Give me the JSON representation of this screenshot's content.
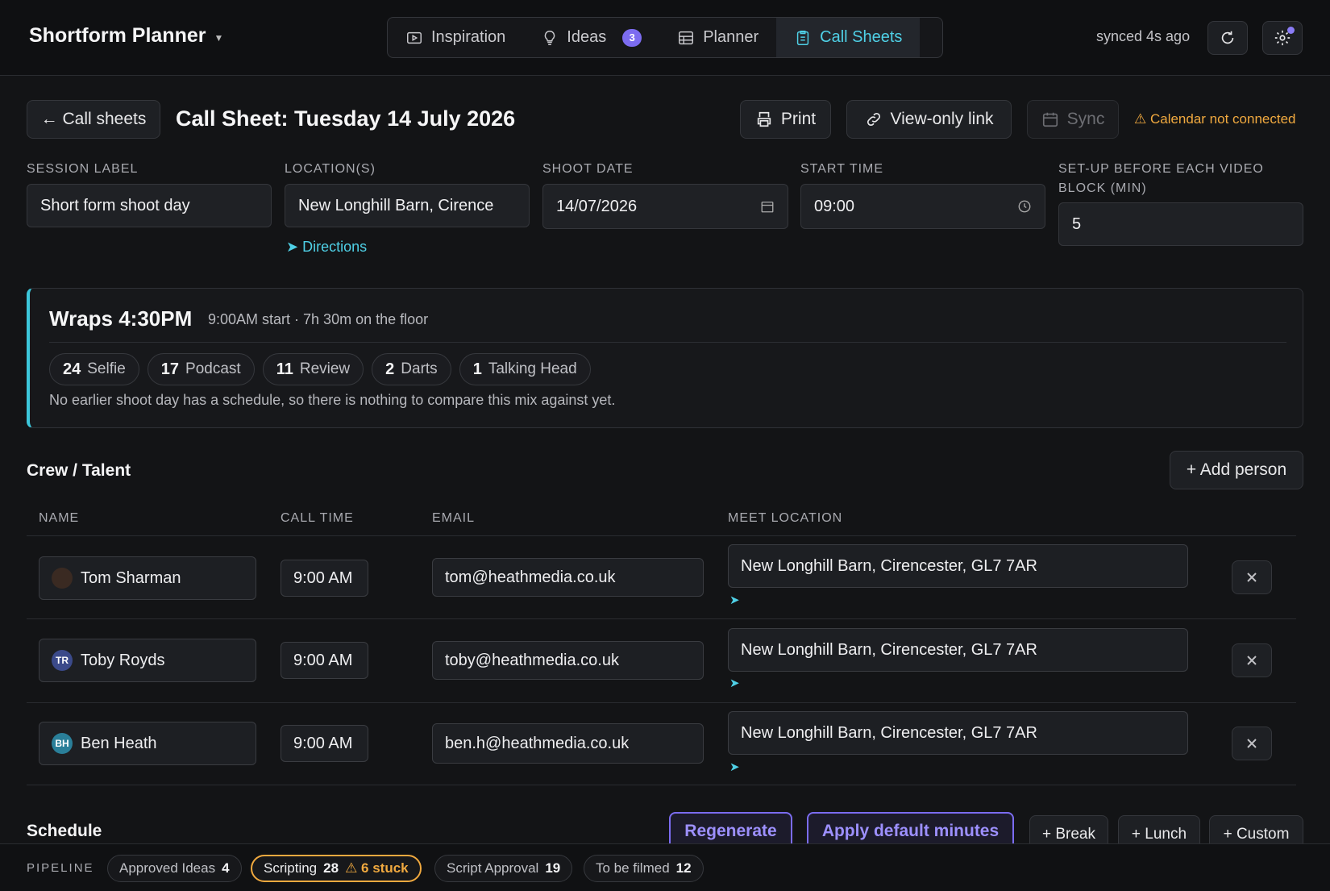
{
  "app": {
    "title": "Shortform Planner"
  },
  "nav": {
    "tabs": [
      {
        "label": "Inspiration",
        "icon": "play-square-icon"
      },
      {
        "label": "Ideas",
        "icon": "lightbulb-icon",
        "badge": "3"
      },
      {
        "label": "Planner",
        "icon": "table-icon"
      },
      {
        "label": "Call Sheets",
        "icon": "clipboard-icon",
        "active": true
      }
    ]
  },
  "status": {
    "synced": "synced 4s ago"
  },
  "header": {
    "back_label": "← Call sheets",
    "title": "Call Sheet: Tuesday 14 July 2026",
    "print_label": "Print",
    "view_link_label": "View-only link",
    "sync_label": "Sync",
    "calendar_warning": "⚠ Calendar not connected"
  },
  "form": {
    "session_label": {
      "label": "SESSION LABEL",
      "value": "Short form shoot day"
    },
    "locations": {
      "label": "LOCATION(S)",
      "value": "New Longhill Barn, Cirence",
      "directions": "➤ Directions"
    },
    "shoot_date": {
      "label": "SHOOT DATE",
      "value": "14/07/2026"
    },
    "start_time": {
      "label": "START TIME",
      "value": "09:00"
    },
    "setup": {
      "label_line1": "SET-UP BEFORE EACH VIDEO",
      "label_line2": "BLOCK (MIN)",
      "value": "5"
    }
  },
  "summary": {
    "wraps": "Wraps 4:30PM",
    "sub": "9:00AM start · 7h 30m on the floor",
    "chips": [
      {
        "count": "24",
        "label": "Selfie"
      },
      {
        "count": "17",
        "label": "Podcast"
      },
      {
        "count": "11",
        "label": "Review"
      },
      {
        "count": "2",
        "label": "Darts"
      },
      {
        "count": "1",
        "label": "Talking Head"
      }
    ],
    "note": "No earlier shoot day has a schedule, so there is nothing to compare this mix against yet."
  },
  "crew": {
    "title": "Crew / Talent",
    "add_label": "+ Add person",
    "columns": [
      "NAME",
      "CALL TIME",
      "EMAIL",
      "MEET LOCATION"
    ],
    "rows": [
      {
        "name": "Tom Sharman",
        "initials": "",
        "avatar_color": "#3a2a22",
        "call_time": "9:00 AM",
        "email": "tom@heathmedia.co.uk",
        "meet": "New Longhill Barn, Cirencester, GL7 7AR",
        "arrow": "➤"
      },
      {
        "name": "Toby Royds",
        "initials": "TR",
        "avatar_color": "#3b4a8a",
        "call_time": "9:00 AM",
        "email": "toby@heathmedia.co.uk",
        "meet": "New Longhill Barn, Cirencester, GL7 7AR",
        "arrow": "➤"
      },
      {
        "name": "Ben Heath",
        "initials": "BH",
        "avatar_color": "#2a7f99",
        "call_time": "9:00 AM",
        "email": "ben.h@heathmedia.co.uk",
        "meet": "New Longhill Barn, Cirencester, GL7 7AR",
        "arrow": "➤"
      }
    ]
  },
  "schedule": {
    "title": "Schedule",
    "regenerate": "Regenerate",
    "apply_default": "Apply default minutes",
    "add_break": "+ Break",
    "add_lunch": "+ Lunch",
    "add_custom": "+ Custom"
  },
  "pipeline": {
    "label": "PIPELINE",
    "stages": [
      {
        "label": "Approved Ideas",
        "count": "4"
      },
      {
        "label": "Scripting",
        "count": "28",
        "warning": "⚠ 6 stuck"
      },
      {
        "label": "Script Approval",
        "count": "19"
      },
      {
        "label": "To be filmed",
        "count": "12"
      }
    ]
  },
  "colors": {
    "accent": "#4fd0e6",
    "purple": "#7b6cf0",
    "warning": "#f0a93f",
    "background": "#131416"
  }
}
